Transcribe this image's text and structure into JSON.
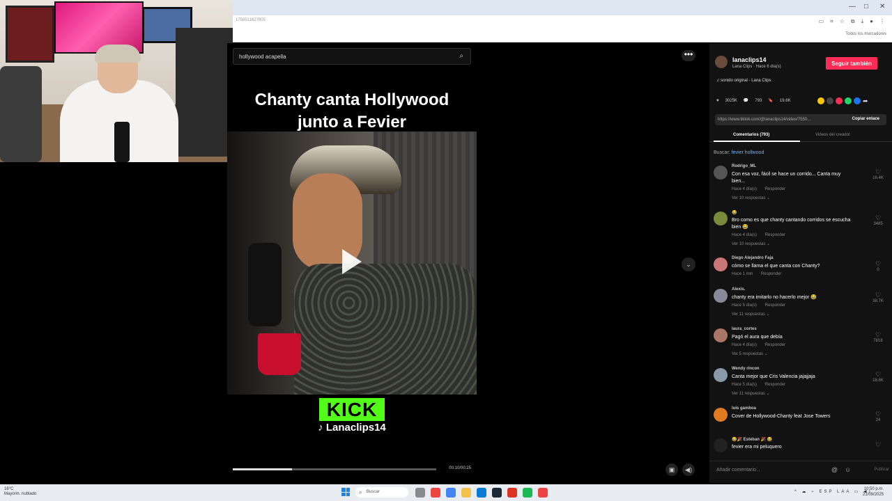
{
  "browser": {
    "url": "1758511627805",
    "bookmarks_label": "Todos los marcadores",
    "window_controls": [
      "—",
      "□",
      "✕"
    ]
  },
  "video": {
    "search_query": "hollywood acapella",
    "overlay_title_line1": "Chanty canta Hollywood",
    "overlay_title_line2": "junto a Fevier",
    "kick_label": "KICK",
    "watermark_handle": "Lanaclips14",
    "time": "00:10/00:25",
    "progress_fraction": 0.29
  },
  "panel": {
    "username": "lanaclips14",
    "subline": "Lana Clips · Hace 6 día(s)",
    "follow_label": "Seguir también",
    "sound": "sonido original - Lana Clips",
    "likes": "3025K",
    "comments_count": "793",
    "saves": "19.6K",
    "link": "https://www.tiktok.com/@lanaclips14/video/7550...",
    "copy_link": "Copiar enlace",
    "tab_comments": "Comentarios (793)",
    "tab_creator": "Videos del creador",
    "search_prefix": "Buscar:",
    "search_term": "fevier hollwood",
    "comments": [
      {
        "user": "Rodrigo_ML",
        "text": "Con esa voz, fácil se hace un corrido... Canta muy bien...",
        "time": "Hace 4 día(s)",
        "reply": "Responder",
        "replies": "Ver 10 respuestas",
        "likes": "16.4K"
      },
      {
        "user": "😂",
        "text": "Bro como es que chanty cantando corridos se escucha bien 😂",
        "time": "Hace 4 día(s)",
        "reply": "Responder",
        "replies": "Ver 10 respuestas",
        "likes": "3485"
      },
      {
        "user": "Diego Alejandro Faja",
        "text": "cómo se llama el que canta con Chanty?",
        "time": "Hace 1 min",
        "reply": "Responder",
        "replies": "",
        "likes": "0"
      },
      {
        "user": "Alexis.",
        "text": "chanty era imitarlo no hacerlo mejor 😂",
        "time": "Hace 5 día(s)",
        "reply": "Responder",
        "replies": "Ver 11 respuestas",
        "likes": "38.7K"
      },
      {
        "user": "laura_cortes",
        "text": "Pagó el aura que debía",
        "time": "Hace 4 día(s)",
        "reply": "Responder",
        "replies": "Ver 5 respuestas",
        "likes": "7818"
      },
      {
        "user": "Wendy rincon",
        "text": "Canta mejor que Cris Valencia jajajjaja",
        "time": "Hace 5 día(s)",
        "reply": "Responder",
        "replies": "Ver 11 respuestas",
        "likes": "18.8K"
      },
      {
        "user": "luis gamboa",
        "text": "Cover de Hollywood-Chanty feat Jose Towers",
        "time": "",
        "reply": "",
        "replies": "",
        "likes": "24"
      },
      {
        "user": "😂🎉 Esteban 🎉 😂",
        "text": "fevier era mi peluquero",
        "time": "",
        "reply": "",
        "replies": "",
        "likes": ""
      }
    ],
    "comment_placeholder": "Añadir comentario...",
    "publish": "Publicar"
  },
  "taskbar": {
    "weather_temp": "16°C",
    "weather_desc": "Mayorm. nublado",
    "search_label": "Buscar",
    "lang": "ESP LAA",
    "time": "10:50 p.m.",
    "date": "21/09/2025"
  },
  "colors": {
    "follow": "#fe2c55",
    "kick": "#53fc18",
    "link": "#6db3ff"
  }
}
